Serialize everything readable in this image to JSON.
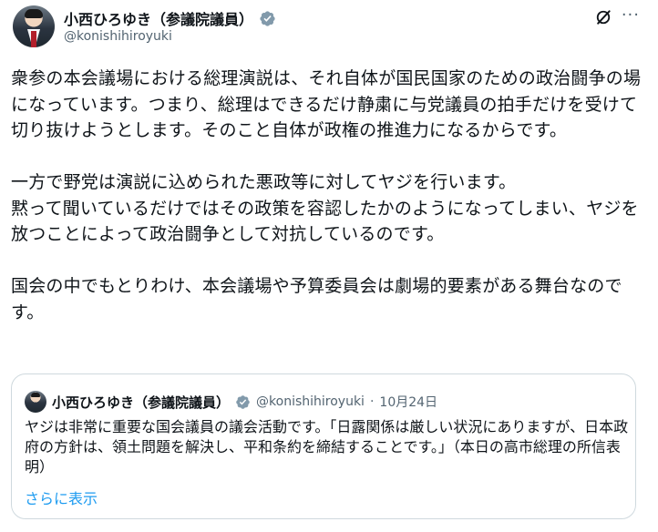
{
  "author": {
    "display_name": "小西ひろゆき（参議院議員）",
    "handle": "@konishihiroyuki",
    "verified_color": "#829aab"
  },
  "actions": {
    "grok_icon": "grok-icon",
    "more_label": "···"
  },
  "post": {
    "text": "衆参の本会議場における総理演説は、それ自体が国民国家のための政治闘争の場になっています。つまり、総理はできるだけ静粛に与党議員の拍手だけを受けて切り抜けようとします。そのこと自体が政権の推進力になるからです。\n\n一方で野党は演説に込められた悪政等に対してヤジを行います。\n黙って聞いているだけではその政策を容認したかのようになってしまい、ヤジを放つことによって政治闘争として対抗しているのです。\n\n国会の中でもとりわけ、本会議場や予算委員会は劇場的要素がある舞台なのです。"
  },
  "quote": {
    "display_name": "小西ひろゆき（参議院議員）",
    "handle": "@konishihiroyuki",
    "dot": "·",
    "date": "10月24日",
    "text": "ヤジは非常に重要な国会議員の議会活動です。「日露関係は厳しい状況にありますが、日本政府の方針は、領土問題を解決し、平和条約を締結することです。」（本日の高市総理の所信表明）",
    "show_more": "さらに表示"
  },
  "colors": {
    "link": "#1d9bf0",
    "secondary_text": "#536471",
    "border": "#cfd9de"
  }
}
